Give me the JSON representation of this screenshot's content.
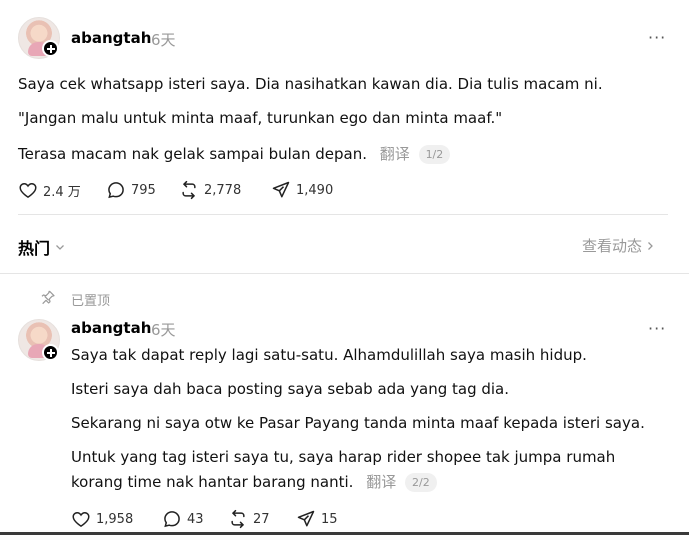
{
  "post": {
    "username": "abangtah",
    "time": "6天",
    "more_label": "···",
    "paragraphs": [
      "Saya cek whatsapp isteri saya. Dia nasihatkan kawan dia. Dia tulis macam ni.",
      "\"Jangan malu untuk minta maaf, turunkan ego dan minta maaf.\"",
      "Terasa macam nak gelak sampai bulan depan."
    ],
    "translate_label": "翻译",
    "pager": "1/2",
    "actions": {
      "likes": "2.4 万",
      "comments": "795",
      "reposts": "2,778",
      "shares": "1,490"
    }
  },
  "replies_bar": {
    "sort_label": "热门",
    "view_activity_label": "查看动态"
  },
  "reply": {
    "pinned_label": "已置顶",
    "username": "abangtah",
    "time": "6天",
    "more_label": "···",
    "paragraphs": [
      "Saya tak dapat reply lagi satu-satu. Alhamdulillah saya masih hidup.",
      "Isteri saya dah baca posting saya sebab ada yang tag dia.",
      "Sekarang ni saya otw ke Pasar Payang tanda minta maaf kepada isteri saya.",
      "Untuk yang tag isteri saya tu, saya harap rider shopee tak jumpa rumah",
      "korang time nak hantar barang nanti."
    ],
    "translate_label": "翻译",
    "pager": "2/2",
    "actions": {
      "likes": "1,958",
      "comments": "43",
      "reposts": "27",
      "shares": "15"
    }
  },
  "colors": {
    "text": "#111111",
    "muted": "#999999",
    "divider": "#e5e5e5",
    "badge_bg": "#f0f0f0"
  },
  "icons": [
    "heart-icon",
    "comment-icon",
    "repost-icon",
    "share-icon",
    "pin-icon",
    "chevron-down-icon",
    "chevron-right-icon",
    "plus-icon",
    "more-icon"
  ]
}
